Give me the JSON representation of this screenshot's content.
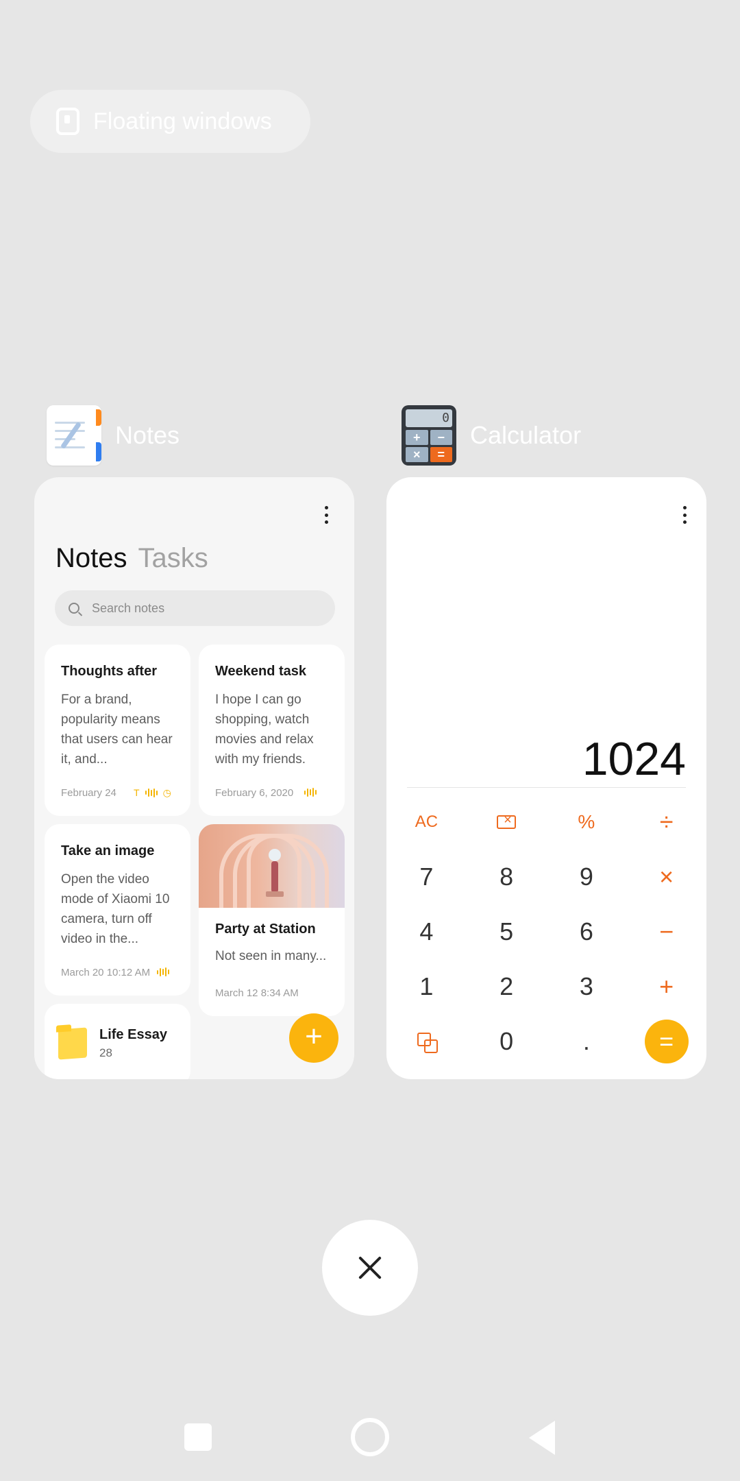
{
  "floating_windows": {
    "label": "Floating windows"
  },
  "apps": {
    "notes": {
      "name": "Notes",
      "tabs": {
        "active": "Notes",
        "inactive": "Tasks"
      },
      "search_placeholder": "Search notes",
      "notes": [
        {
          "title": "Thoughts after",
          "body": "For a brand, popularity means that users can hear it, and...",
          "date": "February 24"
        },
        {
          "title": "Weekend task",
          "body": "I hope I can go shopping, watch movies and relax with my friends.",
          "date": "February 6, 2020"
        },
        {
          "title": "Take an image",
          "body": "Open the video mode of Xiaomi 10 camera, turn off video in the...",
          "date": "March 20 10:12 AM"
        },
        {
          "title": "Party at Station",
          "body": "Not seen in many...",
          "date": "March 12 8:34 AM"
        }
      ],
      "folder": {
        "title": "Life Essay",
        "count": "28"
      },
      "fab_label": "+"
    },
    "calculator": {
      "name": "Calculator",
      "icon_screen": "0",
      "display": "1024",
      "keys": {
        "ac": "AC",
        "percent": "%",
        "divide": "÷",
        "seven": "7",
        "eight": "8",
        "nine": "9",
        "multiply": "×",
        "four": "4",
        "five": "5",
        "six": "6",
        "minus": "−",
        "one": "1",
        "two": "2",
        "three": "3",
        "plus": "+",
        "zero": "0",
        "dot": ".",
        "equals": "="
      }
    }
  },
  "colors": {
    "background": "#e6e6e6",
    "accent_orange": "#ee6a1e",
    "accent_yellow": "#fbb40d"
  },
  "icons": [
    "notes-app-icon",
    "calculator-app-icon",
    "floating-window-icon",
    "kebab-menu-icon",
    "search-icon",
    "close-icon",
    "recents-icon",
    "home-icon",
    "back-icon"
  ]
}
